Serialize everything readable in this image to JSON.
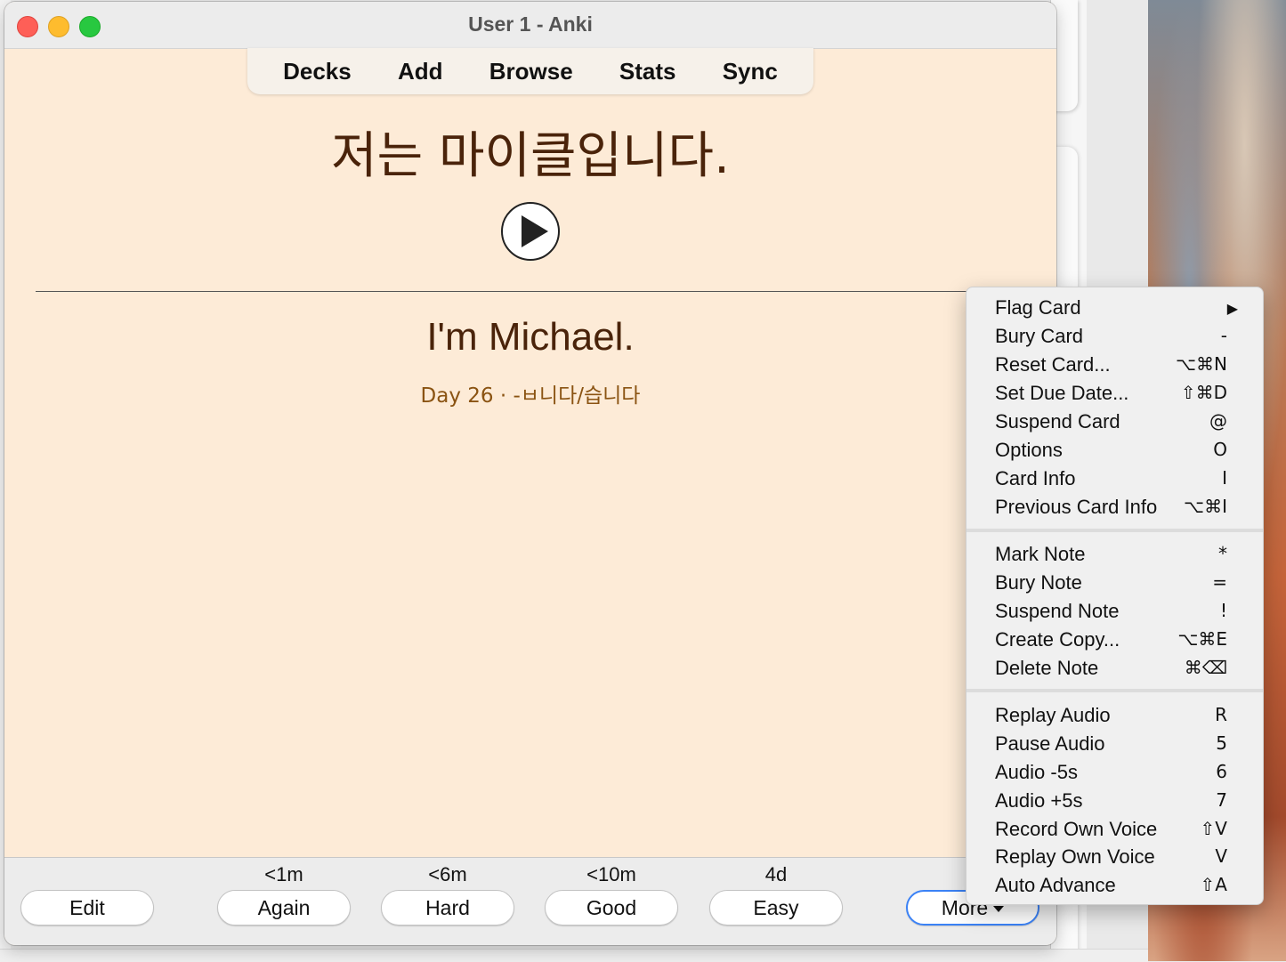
{
  "window": {
    "title": "User 1 - Anki"
  },
  "toolbar": {
    "items": [
      "Decks",
      "Add",
      "Browse",
      "Stats",
      "Sync"
    ]
  },
  "card": {
    "front": "저는 마이클입니다.",
    "back": "I'm Michael.",
    "subtitle": "Day 26 · -ㅂ니다/습니다",
    "play_icon": "play-circle-icon"
  },
  "bottom_bar": {
    "edit_label": "Edit",
    "answers": [
      {
        "time": "<1m",
        "label": "Again"
      },
      {
        "time": "<6m",
        "label": "Hard"
      },
      {
        "time": "<10m",
        "label": "Good"
      },
      {
        "time": "4d",
        "label": "Easy"
      }
    ],
    "more_label": "More"
  },
  "menu": {
    "groups": [
      [
        {
          "label": "Flag Card",
          "shortcut": "▶"
        },
        {
          "label": "Bury Card",
          "shortcut": "-"
        },
        {
          "label": "Reset Card...",
          "shortcut": "⌥⌘N"
        },
        {
          "label": "Set Due Date...",
          "shortcut": "⇧⌘D"
        },
        {
          "label": "Suspend Card",
          "shortcut": "@"
        },
        {
          "label": "Options",
          "shortcut": "O"
        },
        {
          "label": "Card Info",
          "shortcut": "I"
        },
        {
          "label": "Previous Card Info",
          "shortcut": "⌥⌘I"
        }
      ],
      [
        {
          "label": "Mark Note",
          "shortcut": "*"
        },
        {
          "label": "Bury Note",
          "shortcut": "="
        },
        {
          "label": "Suspend Note",
          "shortcut": "!"
        },
        {
          "label": "Create Copy...",
          "shortcut": "⌥⌘E"
        },
        {
          "label": "Delete Note",
          "shortcut": "⌘⌫"
        }
      ],
      [
        {
          "label": "Replay Audio",
          "shortcut": "R"
        },
        {
          "label": "Pause Audio",
          "shortcut": "5"
        },
        {
          "label": "Audio -5s",
          "shortcut": "6"
        },
        {
          "label": "Audio +5s",
          "shortcut": "7"
        },
        {
          "label": "Record Own Voice",
          "shortcut": "⇧V"
        },
        {
          "label": "Replay Own Voice",
          "shortcut": "V"
        },
        {
          "label": "Auto Advance",
          "shortcut": "⇧A"
        }
      ]
    ]
  }
}
